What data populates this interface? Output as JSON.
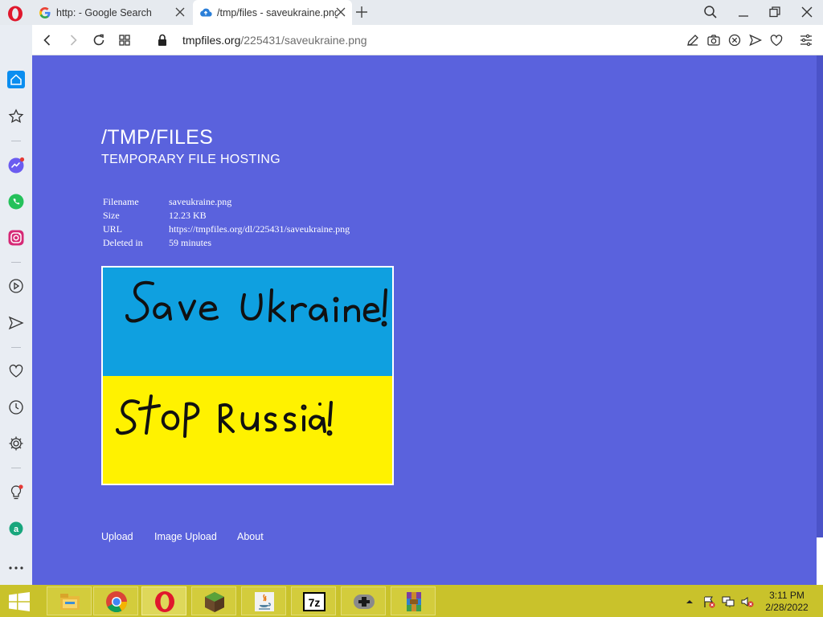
{
  "browser": {
    "tabs": [
      {
        "title": "http: - Google Search",
        "active": false,
        "favicon": "google-icon"
      },
      {
        "title": "/tmp/files - saveukraine.png",
        "active": true,
        "favicon": "cloud-upload-icon"
      }
    ],
    "address": {
      "host": "tmpfiles.org",
      "path": "/225431/saveukraine.png"
    }
  },
  "site": {
    "title": "/TMP/FILES",
    "subtitle": "TEMPORARY FILE HOSTING"
  },
  "file_info": [
    {
      "label": "Filename",
      "value": "saveukraine.png"
    },
    {
      "label": "Size",
      "value": "12.23 KB"
    },
    {
      "label": "URL",
      "value": "https://tmpfiles.org/dl/225431/saveukraine.png"
    },
    {
      "label": "Deleted in",
      "value": "59 minutes"
    }
  ],
  "preview": {
    "line1": "Save Ukraine!",
    "line2": "Stop Russia!",
    "colors": {
      "top": "#0fa0e0",
      "bottom": "#fff200"
    }
  },
  "footer": {
    "links": [
      "Upload",
      "Image Upload",
      "About"
    ]
  },
  "taskbar": {
    "apps": [
      "file-explorer-icon",
      "chrome-icon",
      "opera-icon",
      "minecraft-icon",
      "java-icon",
      "7zip-icon",
      "gamepad-icon",
      "winrar-icon"
    ],
    "time": "3:11 PM",
    "date": "2/28/2022"
  },
  "colors": {
    "page_bg": "#5a62dd",
    "taskbar": "#c9c22b",
    "accent": "#0b8ef0"
  }
}
